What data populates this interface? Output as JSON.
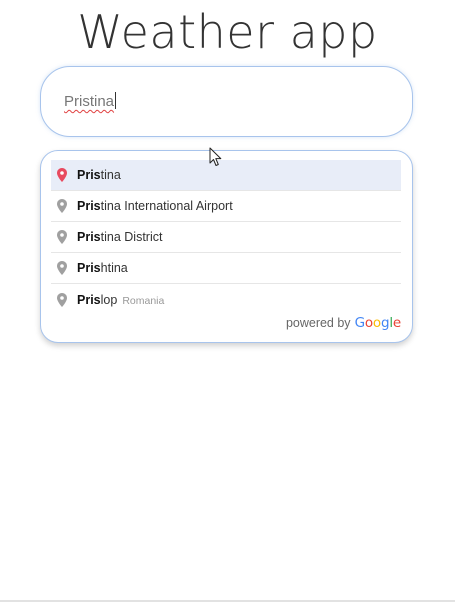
{
  "app": {
    "title": "Weather app"
  },
  "search": {
    "value": "Pristina"
  },
  "suggestions": [
    {
      "match": "Pris",
      "rest": "tina",
      "secondary": "",
      "active": true
    },
    {
      "match": "Pris",
      "rest": "tina International Airport",
      "secondary": "",
      "active": false
    },
    {
      "match": "Pris",
      "rest": "tina District",
      "secondary": "",
      "active": false
    },
    {
      "match": "Pris",
      "rest": "htina",
      "secondary": "",
      "active": false
    },
    {
      "match": "Pris",
      "rest": "lop",
      "secondary": "Romania",
      "active": false
    }
  ],
  "attribution": {
    "powered_by": "powered by",
    "google_letters": [
      "G",
      "o",
      "o",
      "g",
      "l",
      "e"
    ],
    "google_colors": [
      "#4285F4",
      "#EA4335",
      "#FBBC05",
      "#4285F4",
      "#34A853",
      "#EA4335"
    ]
  },
  "icons": {
    "active_pin": "map-pin-icon",
    "inactive_pin": "map-pin-icon"
  },
  "colors": {
    "active_pin": "#e84a5f",
    "inactive_pin": "#a0a0a0",
    "border": "#a8c4ec",
    "active_row": "#e8edf8"
  }
}
